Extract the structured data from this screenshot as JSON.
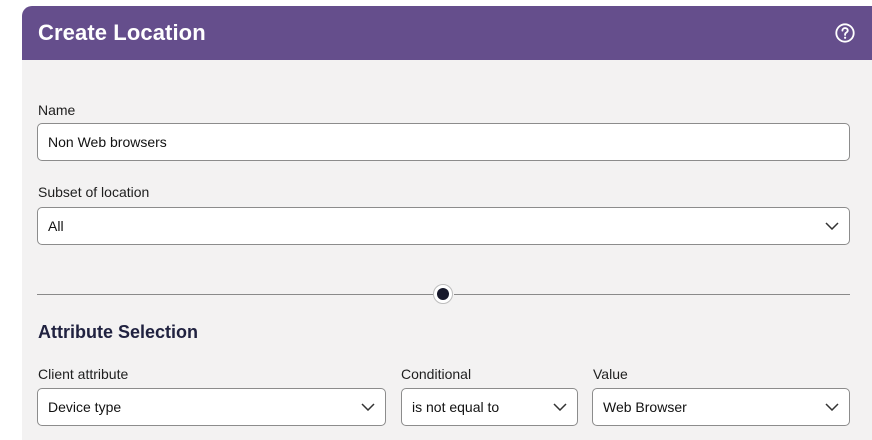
{
  "header": {
    "title": "Create Location",
    "help_icon": "question-circle-icon"
  },
  "form": {
    "name": {
      "label": "Name",
      "value": "Non Web browsers"
    },
    "subset": {
      "label": "Subset of location",
      "value": "All"
    },
    "attribute_section": {
      "title": "Attribute Selection",
      "client_attribute": {
        "label": "Client attribute",
        "value": "Device type"
      },
      "conditional": {
        "label": "Conditional",
        "value": "is not equal to"
      },
      "value": {
        "label": "Value",
        "value": "Web Browser"
      }
    }
  },
  "colors": {
    "header_bg": "#654e8c",
    "panel_bg": "#f3f2f2",
    "input_border": "#8c8c8c"
  }
}
